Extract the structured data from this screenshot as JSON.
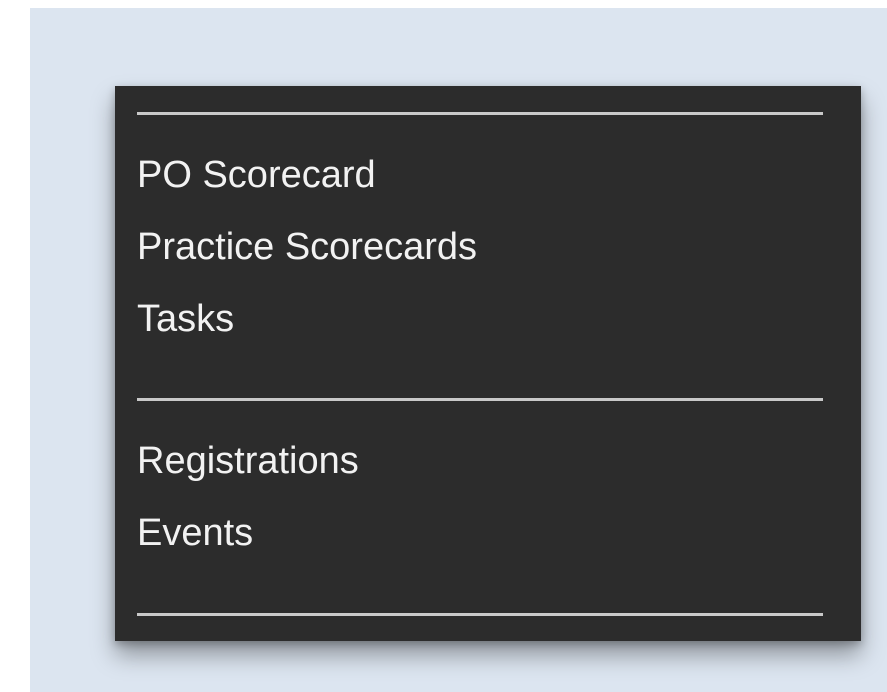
{
  "menu": {
    "group1": {
      "items": [
        {
          "label": "PO Scorecard"
        },
        {
          "label": "Practice Scorecards"
        },
        {
          "label": "Tasks"
        }
      ]
    },
    "group2": {
      "items": [
        {
          "label": "Registrations"
        },
        {
          "label": "Events"
        }
      ]
    }
  },
  "colors": {
    "page_background": "#dce5f0",
    "menu_background": "#2c2c2c",
    "menu_text": "#f2f2f2",
    "divider": "#c9c9c9"
  }
}
